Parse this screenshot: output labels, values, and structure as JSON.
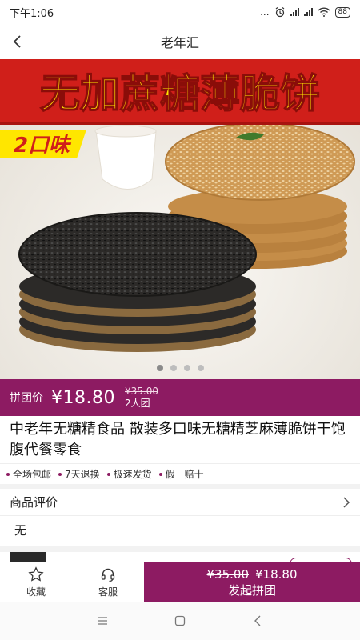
{
  "status_bar": {
    "time": "下午1:06",
    "indicators": "...",
    "battery": "88",
    "icons": [
      "alarm-icon",
      "signal-icon",
      "signal-icon",
      "wifi-icon",
      "battery-icon"
    ]
  },
  "nav": {
    "title": "老年汇",
    "back_icon": "chevron-left-icon"
  },
  "hero": {
    "banner_text": "无加蔗糖薄脆饼",
    "flavor_badge": "2口味",
    "carousel_count": 4,
    "carousel_active": 0
  },
  "price_bar": {
    "label": "拼团价",
    "price": "¥18.80",
    "original_price": "¥35.00",
    "group_size": "2人团"
  },
  "product": {
    "title": "中老年无糖精食品 散装多口味无糖精芝麻薄脆饼干饱腹代餐零食"
  },
  "tags": [
    "全场包邮",
    "7天退换",
    "极速发货",
    "假一赔十"
  ],
  "reviews": {
    "title": "商品评价",
    "empty_text": "无",
    "arrow_icon": "chevron-right-icon"
  },
  "bottom_bar": {
    "favorite_label": "收藏",
    "favorite_icon": "star-icon",
    "service_label": "客服",
    "service_icon": "headset-icon",
    "cta_original": "¥35.00",
    "cta_price": "¥18.80",
    "cta_label": "发起拼团"
  },
  "system_nav": {
    "icons": [
      "menu-icon",
      "home-icon",
      "back-icon"
    ]
  },
  "colors": {
    "accent": "#8d1b62",
    "banner_red": "#d01f1a",
    "banner_yellow": "#ffe600"
  }
}
